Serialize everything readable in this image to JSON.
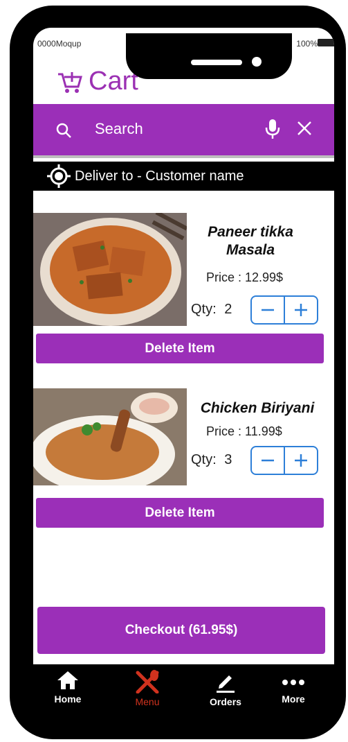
{
  "status": {
    "carrier": "0000Moqup",
    "battery": "100%"
  },
  "header": {
    "title": "Cart",
    "icon": "cart-add-icon"
  },
  "search": {
    "placeholder": "Search"
  },
  "delivery": {
    "label": "Deliver to - Customer name"
  },
  "items": [
    {
      "name_line1": "Paneer tikka",
      "name_line2": "Masala",
      "price": "Price : 12.99$",
      "qty_label": "Qty:",
      "qty": "2",
      "delete_label": "Delete Item"
    },
    {
      "name_line1": "Chicken Biriyani",
      "name_line2": "",
      "price": "Price : 11.99$",
      "qty_label": "Qty:",
      "qty": "3",
      "delete_label": "Delete Item"
    }
  ],
  "checkout": {
    "label": "Checkout (61.95$)"
  },
  "nav": [
    {
      "label": "Home",
      "icon": "home-icon"
    },
    {
      "label": "Menu",
      "icon": "utensils-icon"
    },
    {
      "label": "Orders",
      "icon": "pencil-icon"
    },
    {
      "label": "More",
      "icon": "more-dots-icon"
    }
  ],
  "colors": {
    "accent": "#9b2fb8",
    "stepper": "#2d7fd8",
    "active_nav": "#d0321e",
    "frame": "#000000"
  }
}
